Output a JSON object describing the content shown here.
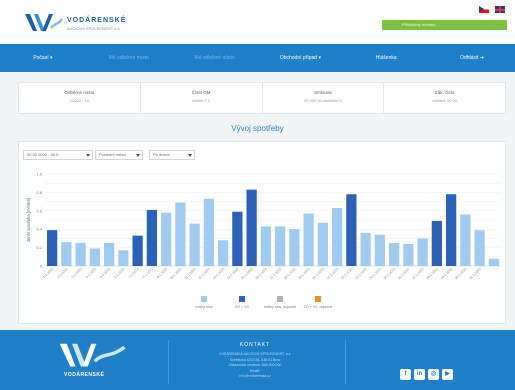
{
  "header": {
    "logo_name": "VODÁRENSKÉ",
    "logo_sub": "AKCIOVÁ SPOLEČNOST a.s.",
    "user_button": "Přihlášený uživatel",
    "colors": {
      "brand": "#1f7fc9",
      "accent": "#7ac142"
    }
  },
  "nav": {
    "items": [
      {
        "label": "Počasí ▾",
        "muted": false
      },
      {
        "label": "Mé odběrné místo",
        "muted": true
      },
      {
        "label": "Mé odběrné místo",
        "muted": true
      },
      {
        "label": "Obchodní případ ▾",
        "muted": false
      },
      {
        "label": "Hlášenka",
        "muted": false
      },
      {
        "label": "Odhlásit ➜",
        "muted": false
      }
    ]
  },
  "info": [
    {
      "label": "Odběrné místo",
      "value": "10000 - 10"
    },
    {
      "label": "Číslo OM",
      "value": "##### 0 0"
    },
    {
      "label": "Smlouva",
      "value": "00 000 00 ####### 0"
    },
    {
      "label": "Zák. číslo",
      "value": "###### 00 00"
    }
  ],
  "section_title": "Vývoj spotřeby",
  "controls": {
    "date_range": "00.00.0000 - 00.0",
    "period": "Poslední měsíc",
    "unit": "Po dnech"
  },
  "chart_data": {
    "type": "bar",
    "ylabel": "denní spotřeba [m³/den]",
    "ylim": [
      0,
      1
    ],
    "yticks": [
      "0",
      "0.1",
      "0.2",
      "0.3",
      "0.4",
      "0.5",
      "0.6",
      "0.7",
      "0.8",
      "0.9",
      "1.0"
    ],
    "categories": [
      "1.1.2021",
      "2.1.2021",
      "3.1.2021",
      "4.1.2021",
      "5.1.2021",
      "6.1.2021",
      "7.1.2021",
      "8.1.2021",
      "9.1.2021",
      "10.1.2021",
      "11.1.2021",
      "12.1.2021",
      "13.1.2021",
      "14.1.2021",
      "15.1.2021",
      "16.1.2021",
      "17.1.2021",
      "18.1.2021",
      "19.1.2021",
      "20.1.2021",
      "21.1.2021",
      "22.1.2021",
      "23.1.2021",
      "24.1.2021",
      "25.1.2021",
      "26.1.2021",
      "27.1.2021",
      "28.1.2021",
      "29.1.2021",
      "30.1.2021",
      "31.1.2021"
    ],
    "values": [
      0.39,
      0.26,
      0.25,
      0.19,
      0.25,
      0.17,
      0.33,
      0.61,
      0.58,
      0.69,
      0.46,
      0.73,
      0.28,
      0.59,
      0.83,
      0.43,
      0.43,
      0.4,
      0.57,
      0.47,
      0.63,
      0.78,
      0.36,
      0.34,
      0.25,
      0.24,
      0.3,
      0.49,
      0.78,
      0.56,
      0.39
    ],
    "kinds": [
      1,
      0,
      0,
      0,
      0,
      0,
      1,
      1,
      0,
      0,
      0,
      0,
      0,
      1,
      1,
      0,
      0,
      0,
      0,
      0,
      0,
      1,
      0,
      0,
      0,
      0,
      0,
      1,
      1,
      0,
      0
    ],
    "last_value": 0.08,
    "series": [
      {
        "name": "reálný stav",
        "color": "#9fcbf0"
      },
      {
        "name": "ZO + VS",
        "color": "#2b62b8"
      },
      {
        "name": "reálný stav, dopočet",
        "color": "#a8b4c2"
      },
      {
        "name": "ZO + VS, dopočet",
        "color": "#f08a2c"
      }
    ]
  },
  "footer": {
    "logo_text": "VODÁRENSKÉ",
    "contact_title": "KONTAKT",
    "contact_lines": [
      "VODÁRENSKÁ AKCIOVÁ SPOLEČNOST, a.s.",
      "Soběšická 820/156, 638 01 Brno",
      "Zákaznické centrum: 800 000 000",
      "Email:",
      "info@vodarenska.cz"
    ],
    "social": [
      "f",
      "in",
      "◎",
      "▶"
    ]
  }
}
